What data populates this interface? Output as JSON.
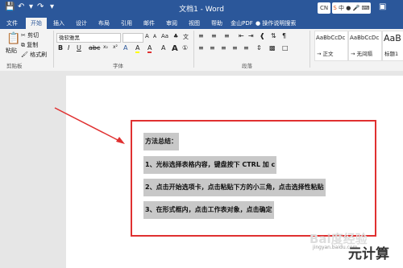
{
  "window": {
    "title": "文档1 - Word",
    "account_initials": "CN"
  },
  "tabs": [
    "文件",
    "开始",
    "插入",
    "设计",
    "布局",
    "引用",
    "邮件",
    "审阅",
    "视图",
    "帮助",
    "金山PDF"
  ],
  "tell_me": "操作说明搜索",
  "clipboard": {
    "paste": "粘贴",
    "cut": "剪切",
    "copy": "复制",
    "format_painter": "格式刷",
    "group": "剪贴板"
  },
  "font": {
    "name": "微软雅黑",
    "size": "",
    "group": "字体",
    "grow": "A",
    "shrink": "A",
    "aa": "Aa",
    "wen": "文",
    "a_big": "A",
    "highlight": "A"
  },
  "paragraph": {
    "group": "段落"
  },
  "styles": [
    {
      "sample": "AaBbCcDc",
      "name": "→ 正文"
    },
    {
      "sample": "AaBbCcDc",
      "name": "→ 无间隔"
    },
    {
      "sample": "AaB",
      "name": "标题1"
    }
  ],
  "document": {
    "lines": [
      "方法总结：",
      "1、光标选择表格内容，键盘按下 CTRL 加 c",
      "2、点击开始选项卡，点击粘贴下方的小三角，点击选择性粘贴",
      "3、在形式框内，点击工作表对象，点击确定"
    ]
  },
  "watermark": {
    "text": "Bai度经验",
    "sub": "jingyan.baidu.com"
  },
  "corner_logo": "元计算",
  "colors": {
    "titlebar": "#2b579a",
    "annotation": "#e03030",
    "selection": "#c8c8c8"
  }
}
